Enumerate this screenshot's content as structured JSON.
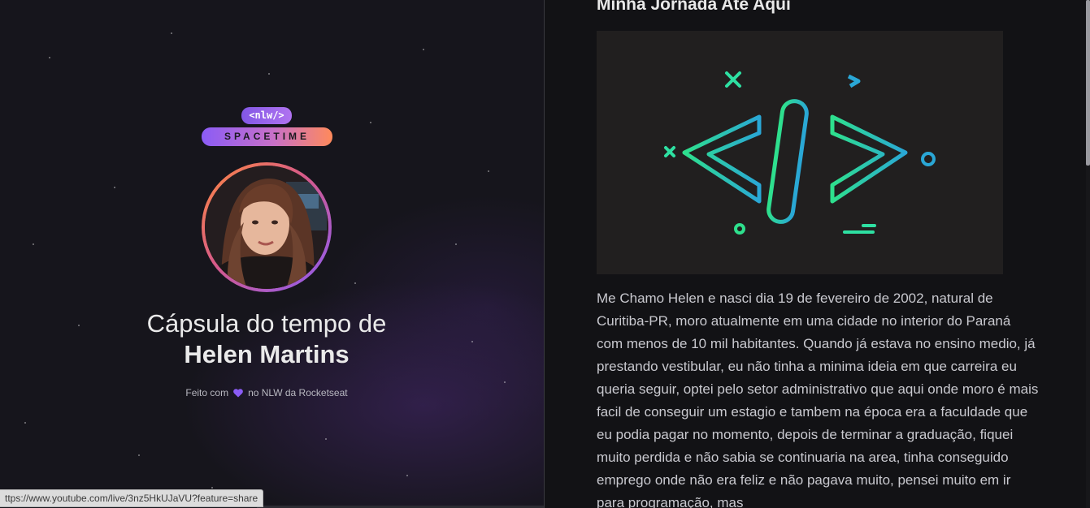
{
  "brand": {
    "tag": "<nlw/>",
    "name": "SPACETIME"
  },
  "profile": {
    "title_prefix": "Cápsula do tempo de",
    "name": "Helen Martins",
    "made_with_before": "Feito com",
    "made_with_after": "no NLW da Rocketseat"
  },
  "memory": {
    "title": "Minha Jornada Até Aqui",
    "image_icon": "code-tag-icon",
    "content": "Me Chamo Helen e nasci dia 19 de fevereiro de 2002, natural de Curitiba-PR, moro atualmente em uma cidade no interior do Paraná com menos de 10 mil habitantes. Quando já estava no ensino medio, já prestando vestibular, eu não tinha a minima ideia em que carreira eu queria seguir, optei pelo setor administrativo que aqui onde moro é mais facil de conseguir um estagio e tambem na época era a faculdade que eu podia pagar no momento, depois de terminar a graduação, fiquei muito perdida e não sabia se continuaria na area, tinha conseguido emprego onde não era feliz e não pagava muito, pensei muito em ir para programação, mas"
  },
  "status_bar": {
    "url": "ttps://www.youtube.com/live/3nz5HkUJaVU?feature=share"
  },
  "colors": {
    "accent_purple": "#8257e5",
    "accent_orange": "#ff8a5b",
    "code_green": "#2bd59b",
    "code_blue": "#2aa7d6"
  }
}
